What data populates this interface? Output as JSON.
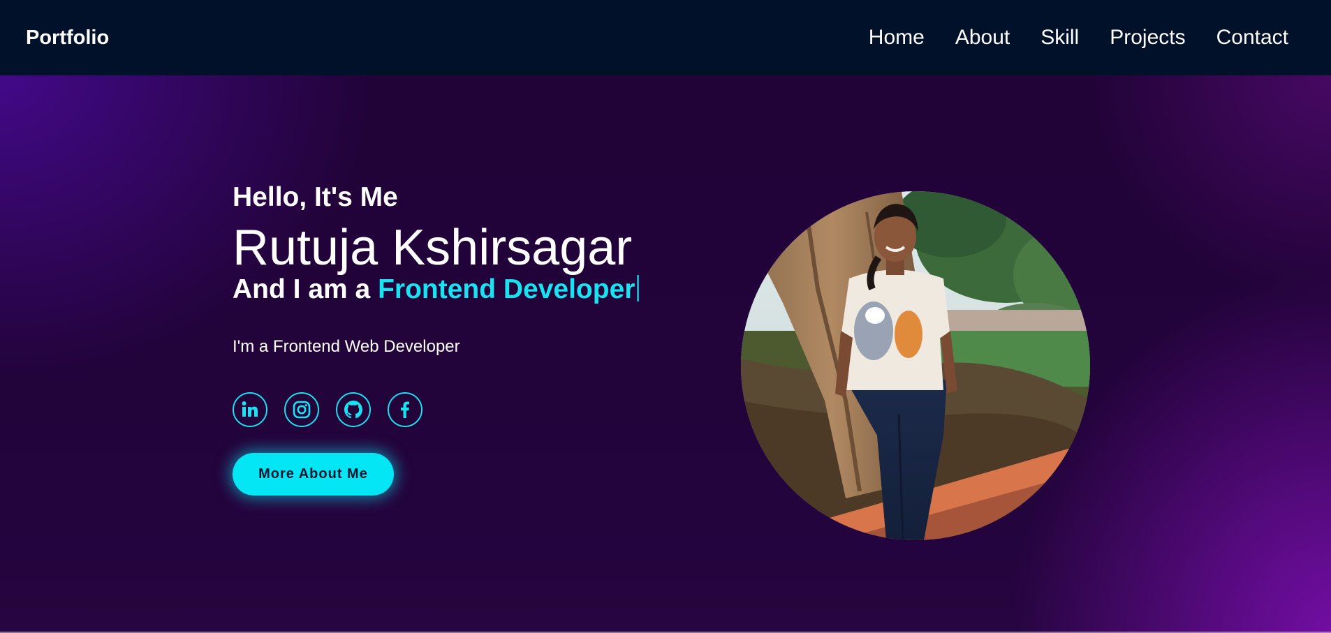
{
  "header": {
    "logo": "Portfolio",
    "nav": [
      "Home",
      "About",
      "Skill",
      "Projects",
      "Contact"
    ]
  },
  "hero": {
    "greeting": "Hello, It's Me",
    "name": "Rutuja Kshirsagar",
    "role_prefix": "And I am a",
    "role": "Frontend Developer",
    "tagline": "I'm a Frontend Web Developer",
    "socials": [
      "linkedin-icon",
      "instagram-icon",
      "github-icon",
      "facebook-icon"
    ],
    "button": "More About Me"
  },
  "colors": {
    "header_bg": "#02112a",
    "hero_bg": "#22033a",
    "accent": "#19e3f0",
    "button_bg": "#05e6f4",
    "text": "#ffffff"
  }
}
